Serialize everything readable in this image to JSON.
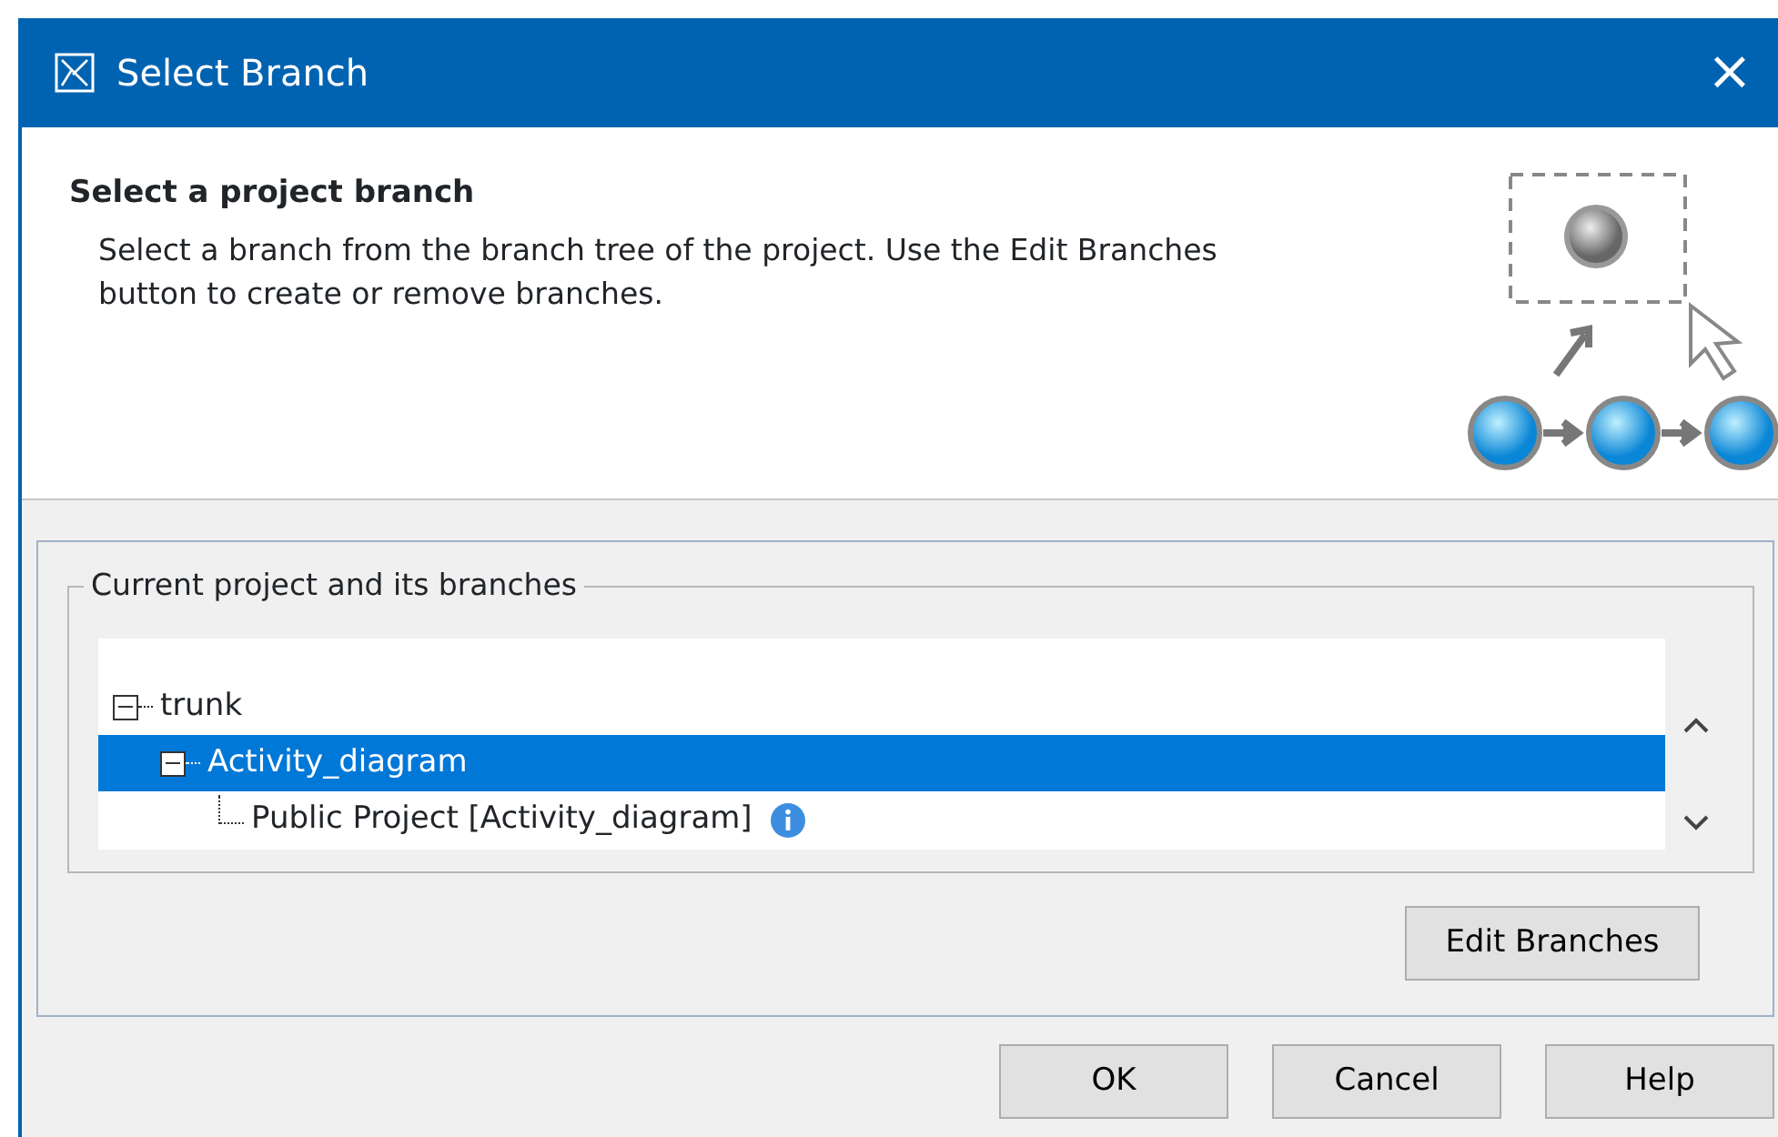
{
  "window": {
    "title": "Select Branch",
    "close": "×"
  },
  "header": {
    "title": "Select a project branch",
    "description": "Select a branch from the branch tree of the project. Use the Edit Branches button to create or remove branches."
  },
  "group": {
    "legend": "Current project and its branches",
    "tree": [
      {
        "label": "trunk",
        "expanded": true,
        "selected": false,
        "children": [
          {
            "label": "Activity_diagram",
            "expanded": true,
            "selected": true,
            "children": [
              {
                "label": "Public Project [Activity_diagram]",
                "selected": false,
                "info": true
              }
            ]
          }
        ]
      }
    ],
    "side_button": "Edit Branches"
  },
  "buttons": [
    "OK",
    "Cancel",
    "Help"
  ]
}
